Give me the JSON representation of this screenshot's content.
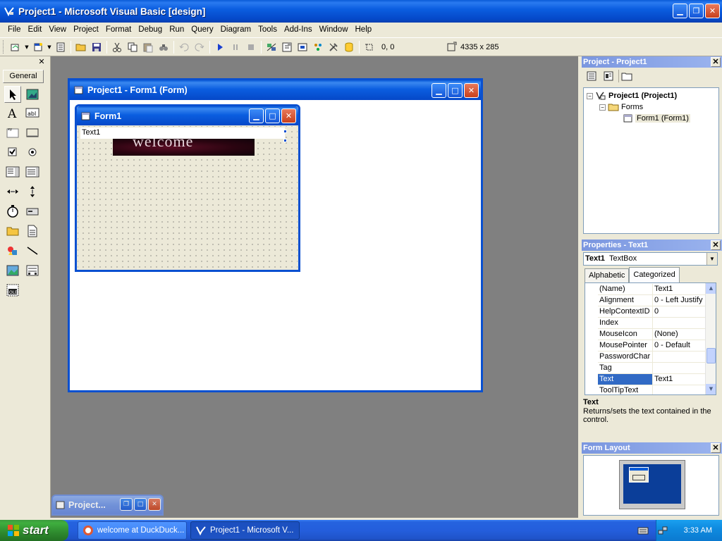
{
  "window": {
    "title": "Project1 - Microsoft Visual Basic [design]"
  },
  "menu": [
    "File",
    "Edit",
    "View",
    "Project",
    "Format",
    "Debug",
    "Run",
    "Query",
    "Diagram",
    "Tools",
    "Add-Ins",
    "Window",
    "Help"
  ],
  "toolbar": {
    "position": "0, 0",
    "size": "4335 x 285"
  },
  "toolbox": {
    "tab_label": "General"
  },
  "designer": {
    "title": "Project1 - Form1 (Form)",
    "form_title": "Form1",
    "textbox_text": "Text1",
    "image_text": "welcome"
  },
  "project_explorer": {
    "title": "Project - Project1",
    "root": "Project1 (Project1)",
    "folder": "Forms",
    "form": "Form1 (Form1)"
  },
  "properties": {
    "title": "Properties - Text1",
    "object_name": "Text1",
    "object_type": "TextBox",
    "tabs": [
      "Alphabetic",
      "Categorized"
    ],
    "rows": [
      {
        "name": "(Name)",
        "value": "Text1"
      },
      {
        "name": "Alignment",
        "value": "0 - Left Justify"
      },
      {
        "name": "HelpContextID",
        "value": "0"
      },
      {
        "name": "Index",
        "value": ""
      },
      {
        "name": "MouseIcon",
        "value": "(None)"
      },
      {
        "name": "MousePointer",
        "value": "0 - Default"
      },
      {
        "name": "PasswordChar",
        "value": ""
      },
      {
        "name": "Tag",
        "value": ""
      },
      {
        "name": "Text",
        "value": "Text1"
      },
      {
        "name": "ToolTipText",
        "value": ""
      }
    ],
    "selected_row": "Text",
    "desc_title": "Text",
    "desc_body": "Returns/sets the text contained in the control."
  },
  "form_layout": {
    "title": "Form Layout"
  },
  "minimized_window": {
    "title": "Project..."
  },
  "taskbar": {
    "start_label": "start",
    "buttons": [
      "welcome at DuckDuck...",
      "Project1 - Microsoft V..."
    ],
    "clock": "3:33 AM"
  },
  "colors": {
    "title_blue": "#0a5bd8",
    "workspace_gray": "#808080",
    "selection_blue": "#316ac5",
    "start_green": "#3c9a3c"
  }
}
